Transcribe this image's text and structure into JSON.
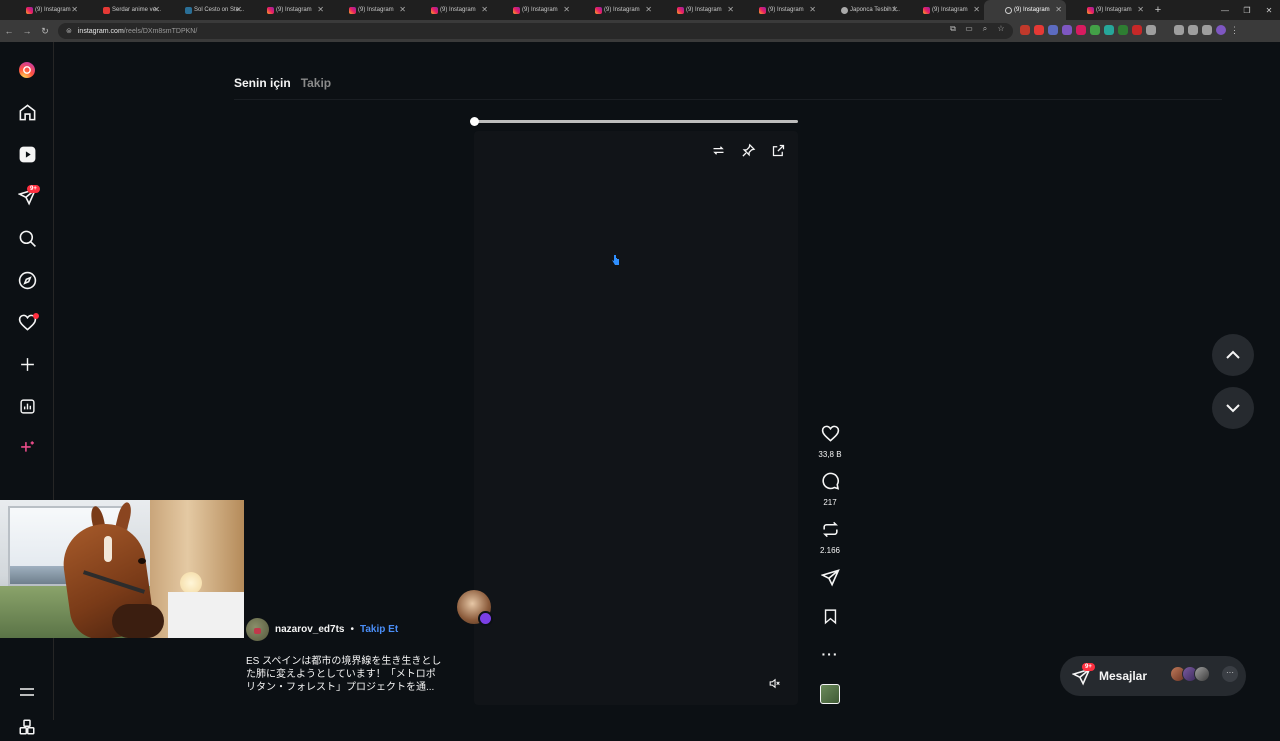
{
  "browser": {
    "tabs": [
      {
        "title": "(9) Instagram",
        "icon": "instagram-icon",
        "active": false
      },
      {
        "title": "Serdar anime ve...",
        "icon": "youtube-icon",
        "active": false
      },
      {
        "title": "Sol Cesto on Ste...",
        "icon": "steam-icon",
        "active": false
      },
      {
        "title": "(9) Instagram",
        "icon": "instagram-icon",
        "active": false
      },
      {
        "title": "(9) Instagram",
        "icon": "instagram-icon",
        "active": false
      },
      {
        "title": "(9) Instagram",
        "icon": "instagram-icon",
        "active": false
      },
      {
        "title": "(9) Instagram",
        "icon": "instagram-icon",
        "active": false
      },
      {
        "title": "(9) Instagram",
        "icon": "instagram-icon",
        "active": false
      },
      {
        "title": "(9) Instagram",
        "icon": "instagram-icon",
        "active": false
      },
      {
        "title": "(9) Instagram",
        "icon": "instagram-icon",
        "active": false
      },
      {
        "title": "Japonca Tesbih f...",
        "icon": "generic-icon",
        "active": false
      },
      {
        "title": "(9) Instagram",
        "icon": "instagram-icon",
        "active": false
      },
      {
        "title": "(9) Instagram",
        "icon": "loading-icon",
        "active": true
      },
      {
        "title": "(9) Instagram",
        "icon": "instagram-icon",
        "active": false
      }
    ],
    "url_host": "instagram.com",
    "url_path": "/reels/DXm8smTDPKN/"
  },
  "sidebar": {
    "notifications_badge": "9+"
  },
  "feed_tabs": {
    "for_you": "Senin için",
    "following": "Takip"
  },
  "player": {
    "progress": 0.0
  },
  "actions": {
    "likes": "33,8 B",
    "comments": "217",
    "reposts": "2.166"
  },
  "post": {
    "username": "nazarov_ed7ts",
    "separator": "•",
    "follow_label": "Takip Et",
    "caption_line1": "ES スペインは都市の境界線を生き生きとし",
    "caption_line2": "た肺に変えようとしています！「メトロポ",
    "caption_line3": "リタン・フォレスト」プロジェクトを通..."
  },
  "messages": {
    "label": "Mesajlar",
    "badge": "9+"
  },
  "colors": {
    "background": "#0c1014",
    "accent_blue": "#4a8df6",
    "badge_red": "#ff3040",
    "sticker_purple": "#7b3fe4"
  }
}
